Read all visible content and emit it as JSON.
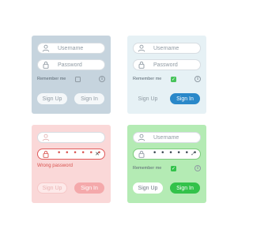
{
  "labels": {
    "username": "Username",
    "password": "Password",
    "remember": "Remember me",
    "sign_up": "Sign Up",
    "sign_in": "Sign In",
    "error": "Wrong password",
    "password_dots": "• • • • • •",
    "info_glyph": "i",
    "invalid_mark": "✕",
    "valid_mark": "✓",
    "check_mark": "✓"
  },
  "panels": [
    {
      "state": "default",
      "remember_checked": false
    },
    {
      "state": "focused",
      "remember_checked": true
    },
    {
      "state": "error",
      "remember_checked": false
    },
    {
      "state": "success",
      "remember_checked": true
    }
  ],
  "colors": {
    "default_panel": "#c6d4de",
    "focused_panel": "#e6f1f5",
    "error_panel": "#fad8d8",
    "success_panel": "#b4ebb4",
    "primary_blue": "#2a88c9",
    "error_red": "#d9534f",
    "success_green": "#32c24a"
  },
  "icons": [
    "user-icon",
    "lock-icon",
    "info-icon",
    "close-icon",
    "check-icon"
  ]
}
